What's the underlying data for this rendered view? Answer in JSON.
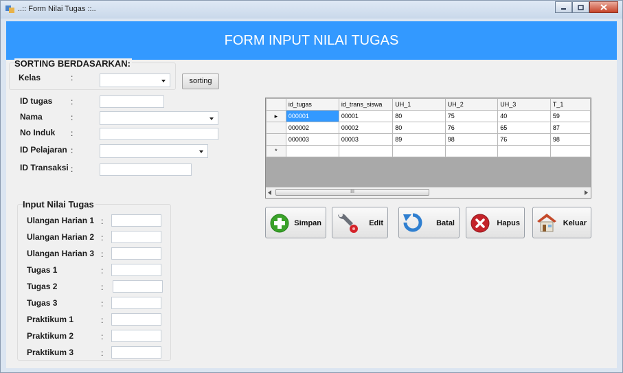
{
  "window": {
    "title": "..:: Form Nilai Tugas ::.."
  },
  "header": {
    "title": "FORM INPUT NILAI TUGAS"
  },
  "sorting": {
    "group_label": "SORTING BERDASARKAN:",
    "kelas_label": "Kelas",
    "kelas_value": "",
    "button_label": "sorting"
  },
  "fields": [
    {
      "label": "ID tugas",
      "value": ""
    },
    {
      "label": "Nama",
      "value": ""
    },
    {
      "label": "No Induk",
      "value": ""
    },
    {
      "label": "ID Pelajaran",
      "value": ""
    },
    {
      "label": "ID Transaksi",
      "value": ""
    }
  ],
  "colon": ":",
  "nilai": {
    "group_label": "Input Nilai Tugas",
    "items": [
      {
        "label": "Ulangan Harian 1",
        "value": ""
      },
      {
        "label": "Ulangan Harian 2",
        "value": ""
      },
      {
        "label": "Ulangan Harian 3",
        "value": ""
      },
      {
        "label": "Tugas 1",
        "value": ""
      },
      {
        "label": "Tugas 2",
        "value": ""
      },
      {
        "label": "Tugas 3",
        "value": ""
      },
      {
        "label": "Praktikum 1",
        "value": ""
      },
      {
        "label": "Praktikum 2",
        "value": ""
      },
      {
        "label": "Praktikum 3",
        "value": ""
      }
    ]
  },
  "grid": {
    "columns": [
      "id_tugas",
      "id_trans_siswa",
      "UH_1",
      "UH_2",
      "UH_3",
      "T_1"
    ],
    "rows": [
      [
        "000001",
        "00001",
        "80",
        "75",
        "40",
        "59"
      ],
      [
        "000002",
        "00002",
        "80",
        "76",
        "65",
        "87"
      ],
      [
        "000003",
        "00003",
        "89",
        "98",
        "76",
        "98"
      ]
    ],
    "current_row_marker": "▸",
    "new_row_marker": "*",
    "scroll_thumb_glyph": "III"
  },
  "actions": [
    {
      "name": "simpan",
      "label": "Simpan",
      "icon": "plus-icon",
      "color": "#3aa229"
    },
    {
      "name": "edit",
      "label": "Edit",
      "icon": "wrench-icon",
      "color": "#d4232a"
    },
    {
      "name": "batal",
      "label": "Batal",
      "icon": "undo-icon",
      "color": "#2f7fd0"
    },
    {
      "name": "hapus",
      "label": "Hapus",
      "icon": "delete-icon",
      "color": "#c4232a"
    },
    {
      "name": "keluar",
      "label": "Keluar",
      "icon": "home-icon",
      "color": "#c44a2a"
    }
  ],
  "colors": {
    "header": "#3399ff",
    "selected_cell": "#3399ff",
    "background": "#f0f0f0"
  }
}
